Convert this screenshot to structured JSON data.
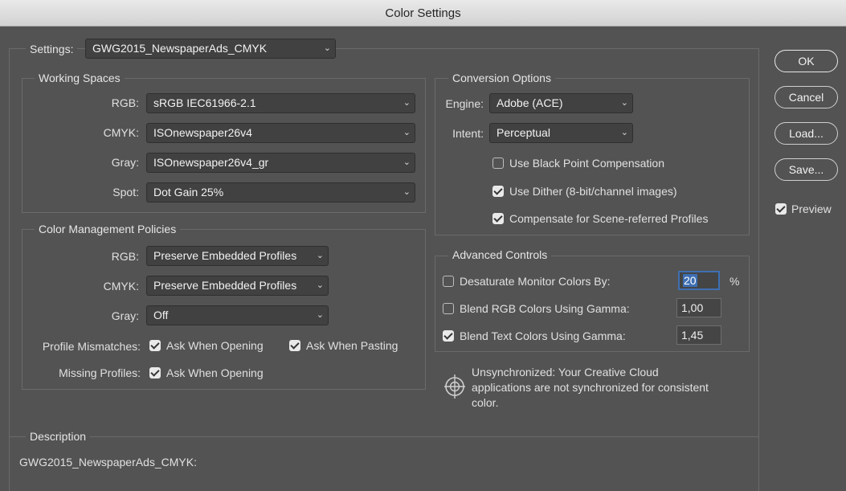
{
  "window": {
    "title": "Color Settings"
  },
  "settings": {
    "label": "Settings:",
    "value": "GWG2015_NewspaperAds_CMYK"
  },
  "working_spaces": {
    "title": "Working Spaces",
    "rgb_label": "RGB:",
    "rgb_value": "sRGB IEC61966-2.1",
    "cmyk_label": "CMYK:",
    "cmyk_value": "ISOnewspaper26v4",
    "gray_label": "Gray:",
    "gray_value": "ISOnewspaper26v4_gr",
    "spot_label": "Spot:",
    "spot_value": "Dot Gain 25%"
  },
  "policies": {
    "title": "Color Management Policies",
    "rgb_label": "RGB:",
    "rgb_value": "Preserve Embedded Profiles",
    "cmyk_label": "CMYK:",
    "cmyk_value": "Preserve Embedded Profiles",
    "gray_label": "Gray:",
    "gray_value": "Off",
    "mismatch_label": "Profile Mismatches:",
    "ask_opening_label": "Ask When Opening",
    "ask_opening_checked": true,
    "ask_pasting_label": "Ask When Pasting",
    "ask_pasting_checked": true,
    "missing_label": "Missing Profiles:",
    "missing_ask_label": "Ask When Opening",
    "missing_ask_checked": true
  },
  "conversion": {
    "title": "Conversion Options",
    "engine_label": "Engine:",
    "engine_value": "Adobe (ACE)",
    "intent_label": "Intent:",
    "intent_value": "Perceptual",
    "bpc_label": "Use Black Point Compensation",
    "bpc_checked": false,
    "dither_label": "Use Dither (8-bit/channel images)",
    "dither_checked": true,
    "scene_label": "Compensate for Scene-referred Profiles",
    "scene_checked": true
  },
  "advanced": {
    "title": "Advanced Controls",
    "desat_label": "Desaturate Monitor Colors By:",
    "desat_checked": false,
    "desat_value": "20",
    "desat_unit": "%",
    "blend_rgb_label": "Blend RGB Colors Using Gamma:",
    "blend_rgb_checked": false,
    "blend_rgb_value": "1,00",
    "blend_text_label": "Blend Text Colors Using Gamma:",
    "blend_text_checked": true,
    "blend_text_value": "1,45"
  },
  "sync": {
    "line1": "Unsynchronized: Your Creative Cloud",
    "line2": "applications are not synchronized for consistent",
    "line3": "color."
  },
  "description": {
    "title": "Description",
    "text": "GWG2015_NewspaperAds_CMYK:"
  },
  "buttons": {
    "ok": "OK",
    "cancel": "Cancel",
    "load": "Load...",
    "save": "Save..."
  },
  "preview": {
    "label": "Preview",
    "checked": true
  }
}
